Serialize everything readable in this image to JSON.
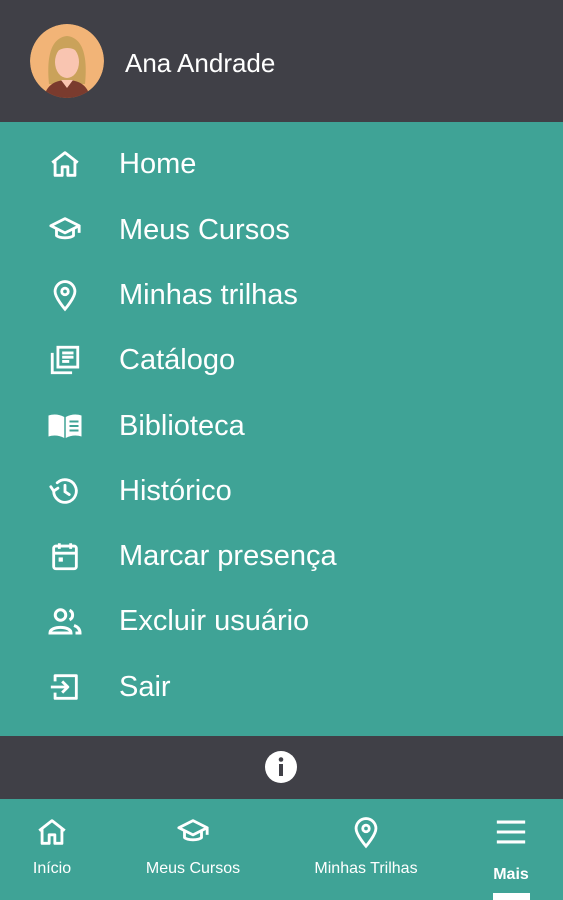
{
  "colors": {
    "header_bg": "#404047",
    "menu_bg": "#3fa396",
    "text": "#ffffff",
    "avatar_bg": "#f2b477",
    "hair": "#caa25a",
    "skin": "#f9c5b1"
  },
  "user": {
    "name": "Ana Andrade",
    "avatar": "avatar-icon"
  },
  "menu": {
    "items": [
      {
        "label": "Home",
        "icon": "home-icon"
      },
      {
        "label": "Meus Cursos",
        "icon": "graduation-cap-icon"
      },
      {
        "label": "Minhas trilhas",
        "icon": "map-pin-icon"
      },
      {
        "label": "Catálogo",
        "icon": "catalog-icon"
      },
      {
        "label": "Biblioteca",
        "icon": "book-icon"
      },
      {
        "label": "Histórico",
        "icon": "history-icon"
      },
      {
        "label": "Marcar presença",
        "icon": "calendar-icon"
      },
      {
        "label": "Excluir usuário",
        "icon": "users-icon"
      },
      {
        "label": "Sair",
        "icon": "exit-icon"
      }
    ]
  },
  "info": {
    "icon": "info-icon"
  },
  "bottom_nav": {
    "items": [
      {
        "label": "Início",
        "icon": "home-icon"
      },
      {
        "label": "Meus Cursos",
        "icon": "graduation-cap-icon"
      },
      {
        "label": "Minhas Trilhas",
        "icon": "map-pin-icon"
      },
      {
        "label": "Mais",
        "icon": "menu-icon",
        "active": true
      }
    ]
  }
}
